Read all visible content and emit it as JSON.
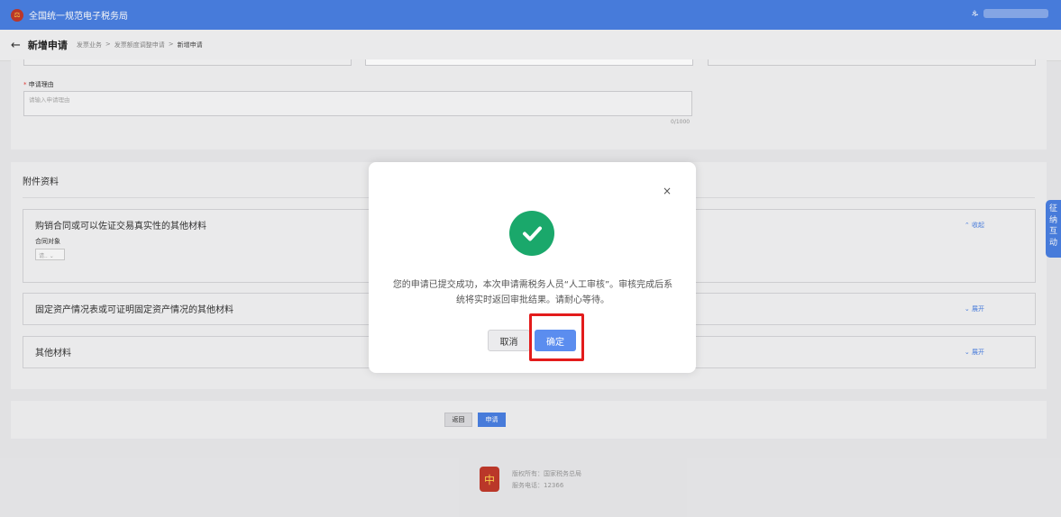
{
  "header": {
    "site_name": "全国统一规范电子税务局",
    "logo_glyph": "⚖",
    "user_icon": "person-icon",
    "user_glyph": "ዹ"
  },
  "subheader": {
    "back_glyph": "←",
    "title": "新增申请",
    "breadcrumb": [
      "发票业务",
      "发票额度调整申请",
      "新增申请"
    ],
    "separator": ">"
  },
  "form": {
    "reason_required_mark": "*",
    "reason_label": "申请理由",
    "reason_placeholder": "请输入申请理由",
    "reason_counter": "0/1000"
  },
  "attachments": {
    "title": "附件资料",
    "sections": [
      {
        "title": "购销合同或可以佐证交易真实性的其他材料",
        "toggle": "⌃ 收起",
        "sub_label": "合同对象",
        "select_value": "请.. ⌄"
      },
      {
        "title": "固定资产情况表或可证明固定资产情况的其他材料",
        "toggle": "⌄ 展开"
      },
      {
        "title": "其他材料",
        "toggle": "⌄ 展开"
      }
    ]
  },
  "bottom_actions": {
    "back_label": "返回",
    "apply_label": "申请"
  },
  "footer": {
    "logo_glyph": "中",
    "copyright": "版权所有：国家税务总局",
    "phone": "服务电话：12366"
  },
  "side_tab": {
    "chars": [
      "征",
      "纳",
      "互",
      "动"
    ]
  },
  "modal": {
    "close_glyph": "×",
    "message": "您的申请已提交成功，本次申请需税务人员“人工审核”。审核完成后系统将实时返回审批结果。请耐心等待。",
    "cancel_label": "取消",
    "confirm_label": "确定",
    "accent_color": "#5b8def",
    "success_color": "#1aa86b",
    "highlight_color": "#e31b1b"
  }
}
